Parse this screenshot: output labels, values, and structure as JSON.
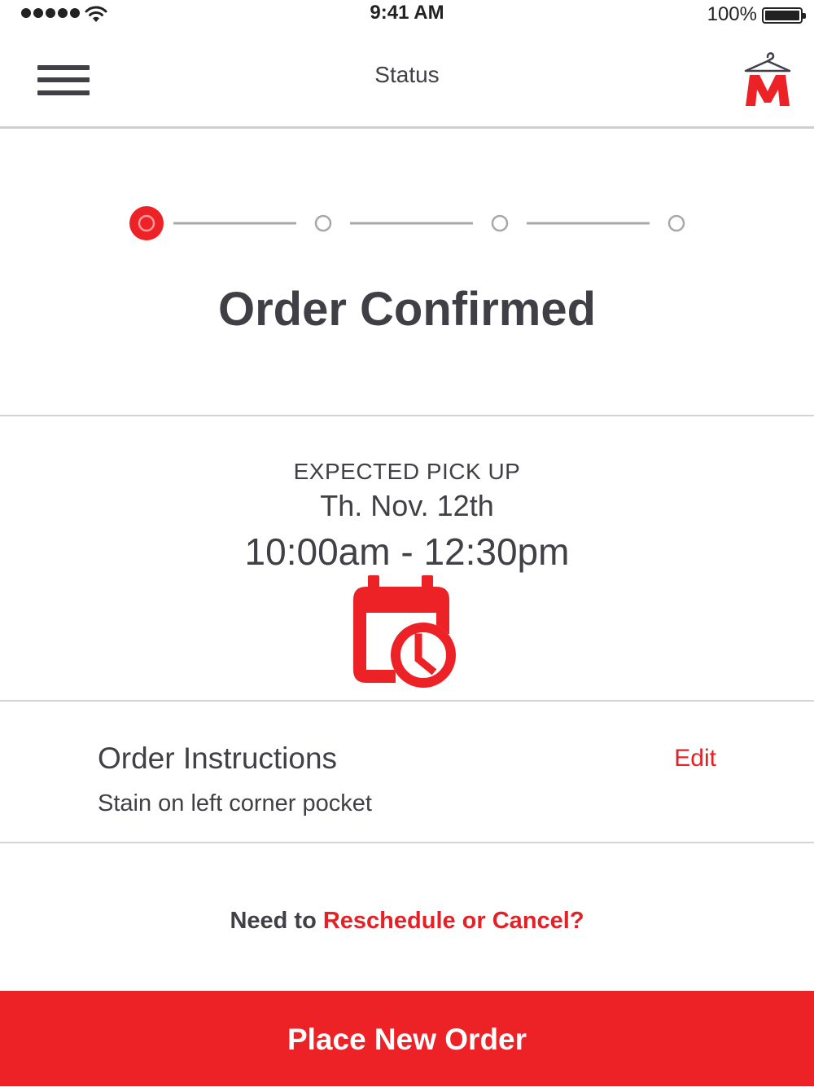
{
  "status_bar": {
    "time": "9:41 AM",
    "battery": "100%",
    "signal_icon": "signal-dots-icon",
    "wifi_icon": "wifi-icon",
    "battery_icon": "battery-icon"
  },
  "nav": {
    "title": "Status",
    "menu_icon": "hamburger-menu-icon",
    "logo_letter": "M"
  },
  "progress": {
    "total_steps": 4,
    "current_step": 1
  },
  "status": {
    "title": "Order Confirmed"
  },
  "pickup": {
    "label": "EXPECTED PICK UP",
    "date": "Th. Nov. 12th",
    "time": "10:00am - 12:30pm",
    "icon": "calendar-clock-icon"
  },
  "instructions": {
    "title": "Order Instructions",
    "edit_label": "Edit",
    "text": "Stain on left corner pocket"
  },
  "reschedule": {
    "prefix": "Need to ",
    "link": "Reschedule or Cancel?"
  },
  "cta": {
    "label": "Place New Order"
  },
  "colors": {
    "accent": "#ed2227",
    "text": "#404046",
    "divider": "#d4d4d4",
    "step_inactive": "#a8a8a8"
  }
}
